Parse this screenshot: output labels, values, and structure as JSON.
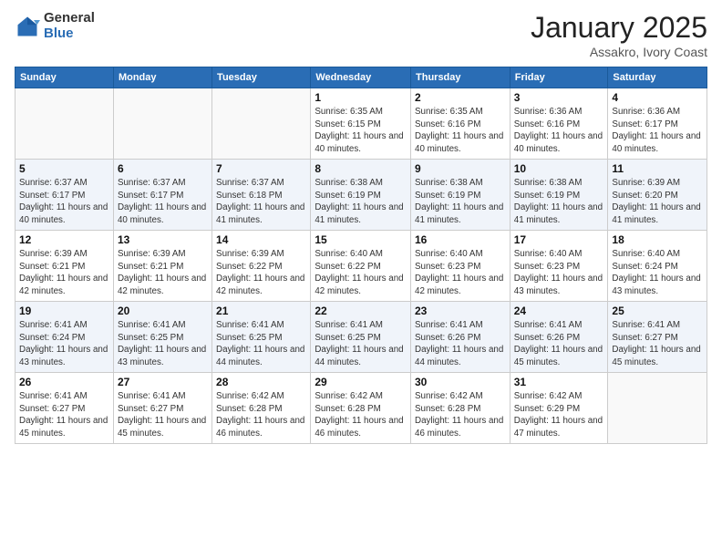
{
  "header": {
    "logo_general": "General",
    "logo_blue": "Blue",
    "month_title": "January 2025",
    "location": "Assakro, Ivory Coast"
  },
  "weekdays": [
    "Sunday",
    "Monday",
    "Tuesday",
    "Wednesday",
    "Thursday",
    "Friday",
    "Saturday"
  ],
  "weeks": [
    [
      {
        "day": "",
        "sunrise": "",
        "sunset": "",
        "daylight": ""
      },
      {
        "day": "",
        "sunrise": "",
        "sunset": "",
        "daylight": ""
      },
      {
        "day": "",
        "sunrise": "",
        "sunset": "",
        "daylight": ""
      },
      {
        "day": "1",
        "sunrise": "Sunrise: 6:35 AM",
        "sunset": "Sunset: 6:15 PM",
        "daylight": "Daylight: 11 hours and 40 minutes."
      },
      {
        "day": "2",
        "sunrise": "Sunrise: 6:35 AM",
        "sunset": "Sunset: 6:16 PM",
        "daylight": "Daylight: 11 hours and 40 minutes."
      },
      {
        "day": "3",
        "sunrise": "Sunrise: 6:36 AM",
        "sunset": "Sunset: 6:16 PM",
        "daylight": "Daylight: 11 hours and 40 minutes."
      },
      {
        "day": "4",
        "sunrise": "Sunrise: 6:36 AM",
        "sunset": "Sunset: 6:17 PM",
        "daylight": "Daylight: 11 hours and 40 minutes."
      }
    ],
    [
      {
        "day": "5",
        "sunrise": "Sunrise: 6:37 AM",
        "sunset": "Sunset: 6:17 PM",
        "daylight": "Daylight: 11 hours and 40 minutes."
      },
      {
        "day": "6",
        "sunrise": "Sunrise: 6:37 AM",
        "sunset": "Sunset: 6:17 PM",
        "daylight": "Daylight: 11 hours and 40 minutes."
      },
      {
        "day": "7",
        "sunrise": "Sunrise: 6:37 AM",
        "sunset": "Sunset: 6:18 PM",
        "daylight": "Daylight: 11 hours and 41 minutes."
      },
      {
        "day": "8",
        "sunrise": "Sunrise: 6:38 AM",
        "sunset": "Sunset: 6:19 PM",
        "daylight": "Daylight: 11 hours and 41 minutes."
      },
      {
        "day": "9",
        "sunrise": "Sunrise: 6:38 AM",
        "sunset": "Sunset: 6:19 PM",
        "daylight": "Daylight: 11 hours and 41 minutes."
      },
      {
        "day": "10",
        "sunrise": "Sunrise: 6:38 AM",
        "sunset": "Sunset: 6:19 PM",
        "daylight": "Daylight: 11 hours and 41 minutes."
      },
      {
        "day": "11",
        "sunrise": "Sunrise: 6:39 AM",
        "sunset": "Sunset: 6:20 PM",
        "daylight": "Daylight: 11 hours and 41 minutes."
      }
    ],
    [
      {
        "day": "12",
        "sunrise": "Sunrise: 6:39 AM",
        "sunset": "Sunset: 6:21 PM",
        "daylight": "Daylight: 11 hours and 42 minutes."
      },
      {
        "day": "13",
        "sunrise": "Sunrise: 6:39 AM",
        "sunset": "Sunset: 6:21 PM",
        "daylight": "Daylight: 11 hours and 42 minutes."
      },
      {
        "day": "14",
        "sunrise": "Sunrise: 6:39 AM",
        "sunset": "Sunset: 6:22 PM",
        "daylight": "Daylight: 11 hours and 42 minutes."
      },
      {
        "day": "15",
        "sunrise": "Sunrise: 6:40 AM",
        "sunset": "Sunset: 6:22 PM",
        "daylight": "Daylight: 11 hours and 42 minutes."
      },
      {
        "day": "16",
        "sunrise": "Sunrise: 6:40 AM",
        "sunset": "Sunset: 6:23 PM",
        "daylight": "Daylight: 11 hours and 42 minutes."
      },
      {
        "day": "17",
        "sunrise": "Sunrise: 6:40 AM",
        "sunset": "Sunset: 6:23 PM",
        "daylight": "Daylight: 11 hours and 43 minutes."
      },
      {
        "day": "18",
        "sunrise": "Sunrise: 6:40 AM",
        "sunset": "Sunset: 6:24 PM",
        "daylight": "Daylight: 11 hours and 43 minutes."
      }
    ],
    [
      {
        "day": "19",
        "sunrise": "Sunrise: 6:41 AM",
        "sunset": "Sunset: 6:24 PM",
        "daylight": "Daylight: 11 hours and 43 minutes."
      },
      {
        "day": "20",
        "sunrise": "Sunrise: 6:41 AM",
        "sunset": "Sunset: 6:25 PM",
        "daylight": "Daylight: 11 hours and 43 minutes."
      },
      {
        "day": "21",
        "sunrise": "Sunrise: 6:41 AM",
        "sunset": "Sunset: 6:25 PM",
        "daylight": "Daylight: 11 hours and 44 minutes."
      },
      {
        "day": "22",
        "sunrise": "Sunrise: 6:41 AM",
        "sunset": "Sunset: 6:25 PM",
        "daylight": "Daylight: 11 hours and 44 minutes."
      },
      {
        "day": "23",
        "sunrise": "Sunrise: 6:41 AM",
        "sunset": "Sunset: 6:26 PM",
        "daylight": "Daylight: 11 hours and 44 minutes."
      },
      {
        "day": "24",
        "sunrise": "Sunrise: 6:41 AM",
        "sunset": "Sunset: 6:26 PM",
        "daylight": "Daylight: 11 hours and 45 minutes."
      },
      {
        "day": "25",
        "sunrise": "Sunrise: 6:41 AM",
        "sunset": "Sunset: 6:27 PM",
        "daylight": "Daylight: 11 hours and 45 minutes."
      }
    ],
    [
      {
        "day": "26",
        "sunrise": "Sunrise: 6:41 AM",
        "sunset": "Sunset: 6:27 PM",
        "daylight": "Daylight: 11 hours and 45 minutes."
      },
      {
        "day": "27",
        "sunrise": "Sunrise: 6:41 AM",
        "sunset": "Sunset: 6:27 PM",
        "daylight": "Daylight: 11 hours and 45 minutes."
      },
      {
        "day": "28",
        "sunrise": "Sunrise: 6:42 AM",
        "sunset": "Sunset: 6:28 PM",
        "daylight": "Daylight: 11 hours and 46 minutes."
      },
      {
        "day": "29",
        "sunrise": "Sunrise: 6:42 AM",
        "sunset": "Sunset: 6:28 PM",
        "daylight": "Daylight: 11 hours and 46 minutes."
      },
      {
        "day": "30",
        "sunrise": "Sunrise: 6:42 AM",
        "sunset": "Sunset: 6:28 PM",
        "daylight": "Daylight: 11 hours and 46 minutes."
      },
      {
        "day": "31",
        "sunrise": "Sunrise: 6:42 AM",
        "sunset": "Sunset: 6:29 PM",
        "daylight": "Daylight: 11 hours and 47 minutes."
      },
      {
        "day": "",
        "sunrise": "",
        "sunset": "",
        "daylight": ""
      }
    ]
  ]
}
